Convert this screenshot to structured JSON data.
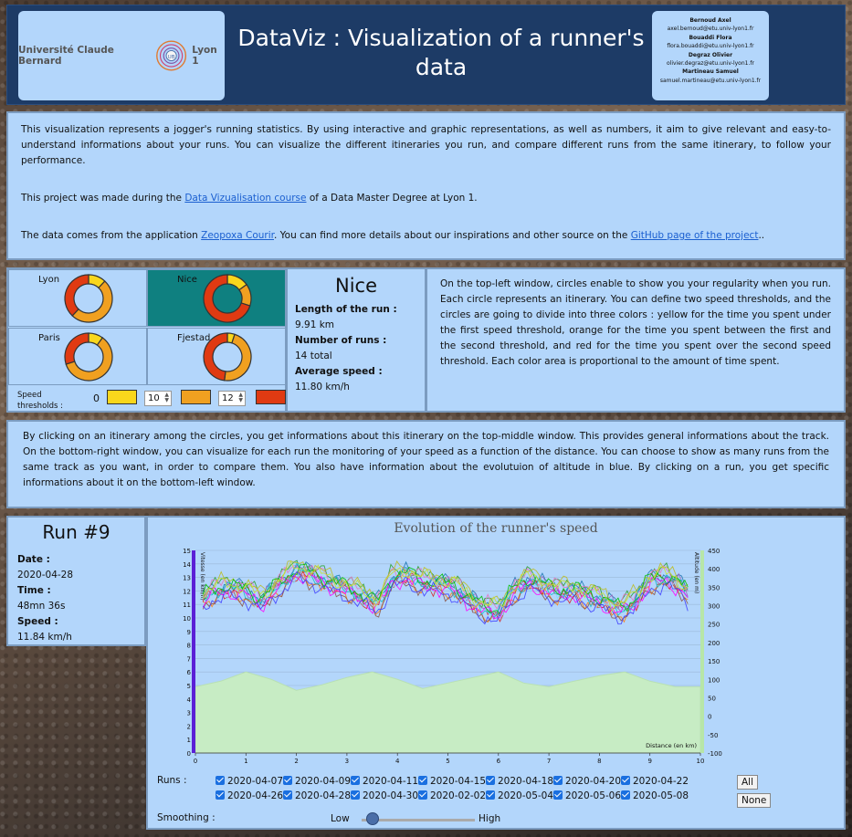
{
  "header": {
    "title": "DataViz : Visualization of a runner's data",
    "logo_left": "Université Claude Bernard",
    "logo_right": "Lyon 1",
    "authors": [
      {
        "name": "Bernoud Axel",
        "email": "axel.bernoud@etu.univ-lyon1.fr"
      },
      {
        "name": "Bouaddi Flora",
        "email": "flora.bouaddi@etu.univ-lyon1.fr"
      },
      {
        "name": "Degraz Olivier",
        "email": "olivier.degraz@etu.univ-lyon1.fr"
      },
      {
        "name": "Martineau Samuel",
        "email": "samuel.martineau@etu.univ-lyon1.fr"
      }
    ]
  },
  "intro": {
    "p1": "This visualization represents a jogger's running statistics. By using interactive and graphic representations, as well as numbers, it aim to give relevant and easy-to-understand informations about your runs. You can visualize the different itineraries you run, and compare different runs from the same itinerary, to follow your performance.",
    "p2_before": "This project was made during the ",
    "p2_link": "Data Vizualisation course",
    "p2_after": " of a Data Master Degree at Lyon 1.",
    "p3_before": "The data comes from the application ",
    "p3_link1": "Zeopoxa Courir",
    "p3_mid": ". You can find more details about our inspirations and other source on the ",
    "p3_link2": "GitHub page of the project",
    "p3_after": ".."
  },
  "circles": {
    "items": [
      {
        "label": "Lyon",
        "yellow": 0.12,
        "orange": 0.5,
        "red": 0.38
      },
      {
        "label": "Nice",
        "yellow": 0.15,
        "orange": 0.15,
        "red": 0.7
      },
      {
        "label": "Paris",
        "yellow": 0.1,
        "orange": 0.6,
        "red": 0.3
      },
      {
        "label": "Fjestad",
        "yellow": 0.05,
        "orange": 0.47,
        "red": 0.48
      }
    ],
    "selected": "Nice",
    "thresholds_label": "Speed thresholds :",
    "threshold_start": "0",
    "threshold1": "10",
    "threshold2": "12",
    "colors": {
      "yellow": "#f9d71c",
      "orange": "#f0a020",
      "red": "#e03a12",
      "selected_bg": "#0f8080"
    }
  },
  "info": {
    "title": "Nice",
    "length_label": "Length of the run :",
    "length": "9.91 km",
    "runs_label": "Number of runs :",
    "runs": "14 total",
    "speed_label": "Average speed :",
    "speed": "11.80 km/h"
  },
  "desc1": "On the top-left window, circles enable to show you your regularity when you run. Each circle represents an itinerary. You can define two speed thresholds, and the circles are going to divide into three colors : yellow for the time you spent under the first speed threshold, orange for the time you spent between the first and the second threshold, and red for the time you spent over the second speed threshold. Each color area is proportional to the amount of time spent.",
  "desc2": "By clicking on an itinerary among the circles, you get informations about this itinerary on the top-middle window. This provides general informations about the track. On the bottom-right window, you can visualize for each run the monitoring of your speed as a function of the distance. You can choose to show as many runs from the same track as you want, in order to compare them. You also have information about the evolutuion of altitude in blue. By clicking on a run, you get specific informations about it on the bottom-left window.",
  "run": {
    "title": "Run #9",
    "date_label": "Date :",
    "date": "2020-04-28",
    "time_label": "Time :",
    "time": "48mn 36s",
    "speed_label": "Speed :",
    "speed": "11.84 km/h"
  },
  "chart_data": {
    "type": "line",
    "title": "Evolution of the runner's speed",
    "ylabel": "Vitesse (en km/h)",
    "y2label": "Altitude (en m)",
    "xlabel": "Distance (en km)",
    "xlim": [
      0,
      10
    ],
    "ylim": [
      0,
      15
    ],
    "y2lim": [
      -100,
      450
    ],
    "x_ticks": [
      "0",
      "1",
      "2",
      "3",
      "4",
      "5",
      "6",
      "7",
      "8",
      "9",
      "10"
    ],
    "y_ticks": [
      "0",
      "1",
      "2",
      "3",
      "4",
      "5",
      "6",
      "7",
      "8",
      "9",
      "10",
      "11",
      "12",
      "13",
      "14",
      "15"
    ],
    "y2_ticks": [
      "-100",
      "-50",
      "0",
      "50",
      "100",
      "150",
      "200",
      "250",
      "300",
      "350",
      "400",
      "450"
    ],
    "speed_profile": {
      "x": [
        0.0,
        0.3,
        0.6,
        1.0,
        1.3,
        1.6,
        2.0,
        2.3,
        2.7,
        3.0,
        3.3,
        3.6,
        3.9,
        4.2,
        4.5,
        4.8,
        5.1,
        5.4,
        5.7,
        6.0,
        6.3,
        6.6,
        6.9,
        7.2,
        7.5,
        7.8,
        8.1,
        8.4,
        8.7,
        9.0,
        9.3,
        9.6,
        9.8
      ],
      "y": [
        10.8,
        11.9,
        12.2,
        12.0,
        11.2,
        12.3,
        13.5,
        13.2,
        12.5,
        12.2,
        11.6,
        11.0,
        12.9,
        13.2,
        12.6,
        12.5,
        12.3,
        11.4,
        10.7,
        10.4,
        12.0,
        12.8,
        12.3,
        11.9,
        12.0,
        11.6,
        11.2,
        10.6,
        11.2,
        12.8,
        13.0,
        12.4,
        11.6
      ]
    },
    "altitude": {
      "x": [
        0.0,
        0.5,
        1.0,
        1.5,
        2.0,
        2.5,
        3.0,
        3.5,
        4.0,
        4.5,
        5.0,
        5.5,
        6.0,
        6.5,
        7.0,
        7.5,
        8.0,
        8.5,
        9.0,
        9.5,
        10.0
      ],
      "y": [
        80,
        95,
        120,
        100,
        70,
        85,
        105,
        120,
        100,
        75,
        90,
        105,
        120,
        90,
        80,
        95,
        110,
        120,
        95,
        80,
        80
      ]
    },
    "series": [
      {
        "name": "2020-04-07",
        "offset": 0.3,
        "color": "#1f77b4"
      },
      {
        "name": "2020-04-09",
        "offset": -0.4,
        "color": "#ff7f0e"
      },
      {
        "name": "2020-04-11",
        "offset": 0.5,
        "color": "#2ca02c"
      },
      {
        "name": "2020-04-15",
        "offset": -0.2,
        "color": "#d62728"
      },
      {
        "name": "2020-04-18",
        "offset": 0.1,
        "color": "#9467bd"
      },
      {
        "name": "2020-04-20",
        "offset": -0.5,
        "color": "#8c564b"
      },
      {
        "name": "2020-04-22",
        "offset": 0.4,
        "color": "#e377c2"
      },
      {
        "name": "2020-04-26",
        "offset": -0.1,
        "color": "#7fdbff"
      },
      {
        "name": "2020-04-28",
        "offset": 0.0,
        "color": "#17becf"
      },
      {
        "name": "2020-04-30",
        "offset": 0.6,
        "color": "#bcbd22"
      },
      {
        "name": "2020-02-02",
        "offset": -0.3,
        "color": "#ff00ff"
      },
      {
        "name": "2020-05-04",
        "offset": 0.2,
        "color": "#00c000"
      },
      {
        "name": "2020-05-06",
        "offset": -0.6,
        "color": "#4040ff"
      },
      {
        "name": "2020-05-08",
        "offset": 0.35,
        "color": "#c8e030"
      }
    ]
  },
  "controls": {
    "runs_label": "Runs :",
    "all_label": "All",
    "none_label": "None",
    "smoothing_label": "Smoothing :",
    "low_label": "Low",
    "high_label": "High",
    "smoothing_value": 0.05
  }
}
